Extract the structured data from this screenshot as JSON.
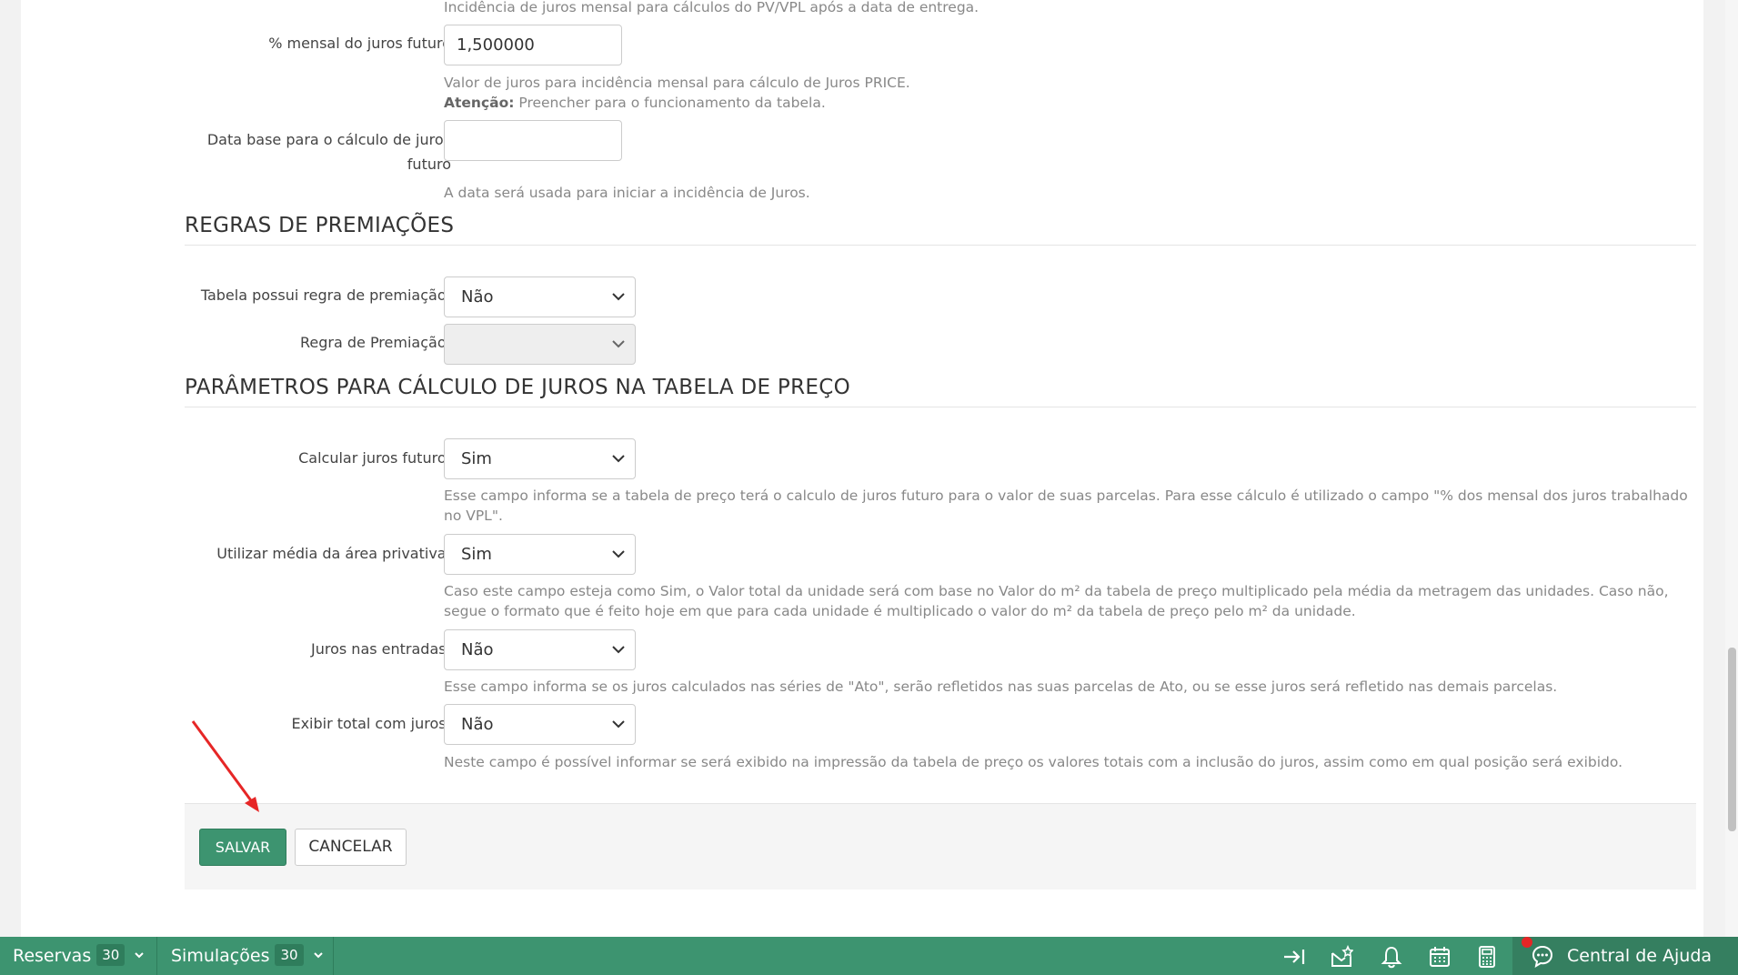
{
  "fields_top": {
    "vpl_help": "Incidência de juros mensal para cálculos do PV/VPL após a data de entrega.",
    "juros_futuro_label": "% mensal do juros futuro",
    "juros_futuro_value": "1,500000",
    "juros_futuro_help": "Valor de juros para incidência mensal para cálculo de Juros PRICE.",
    "juros_futuro_attention_label": "Atenção:",
    "juros_futuro_attention_text": " Preencher para o funcionamento da tabela.",
    "data_base_label_line1": "Data base para o cálculo de juros",
    "data_base_label_line2": "futuro",
    "data_base_value": "",
    "data_base_help": "A data será usada para iniciar a incidência de Juros."
  },
  "premiacoes": {
    "title": "REGRAS DE PREMIAÇÕES",
    "possui_label": "Tabela possui regra de premiação:",
    "possui_value": "Não",
    "regra_label": "Regra de Premiação:",
    "regra_value": ""
  },
  "parametros": {
    "title": "PARÂMETROS PARA CÁLCULO DE JUROS NA TABELA DE PREÇO",
    "calcular_label": "Calcular juros futuro:",
    "calcular_value": "Sim",
    "calcular_help": "Esse campo informa se a tabela de preço terá o calculo de juros futuro para o valor de suas parcelas. Para esse cálculo é utilizado o campo \"% dos mensal dos juros trabalhado no VPL\".",
    "media_label": "Utilizar média da área privativa:",
    "media_value": "Sim",
    "media_help": "Caso este campo esteja como Sim, o Valor total da unidade será com base no Valor do m² da tabela de preço multiplicado pela média da metragem das unidades. Caso não, segue o formato que é feito hoje em que para cada unidade é multiplicado o valor do m² da tabela de preço pelo m² da unidade.",
    "entradas_label": "Juros nas entradas:",
    "entradas_value": "Não",
    "entradas_help": "Esse campo informa se os juros calculados nas séries de \"Ato\", serão refletidos nas suas parcelas de Ato, ou se esse juros será refletido nas demais parcelas.",
    "exibir_label": "Exibir total com juros:",
    "exibir_value": "Não",
    "exibir_help": "Neste campo é possível informar se será exibido na impressão da tabela de preço os valores totais com a inclusão do juros, assim como em qual posição será exibido."
  },
  "actions": {
    "save_label": "SALVAR",
    "cancel_label": "CANCELAR"
  },
  "bottombar": {
    "reservas_label": "Reservas",
    "reservas_count": "30",
    "simulacoes_label": "Simulações",
    "simulacoes_count": "30",
    "help_label": "Central de Ajuda",
    "icons": [
      "sidebar-collapse-icon",
      "mail-star-icon",
      "bell-icon",
      "calendar-icon",
      "calculator-icon",
      "chat-icon"
    ]
  },
  "colors": {
    "primary": "#3d9470",
    "notification": "#e62626",
    "annotation_arrow": "#e62626"
  }
}
